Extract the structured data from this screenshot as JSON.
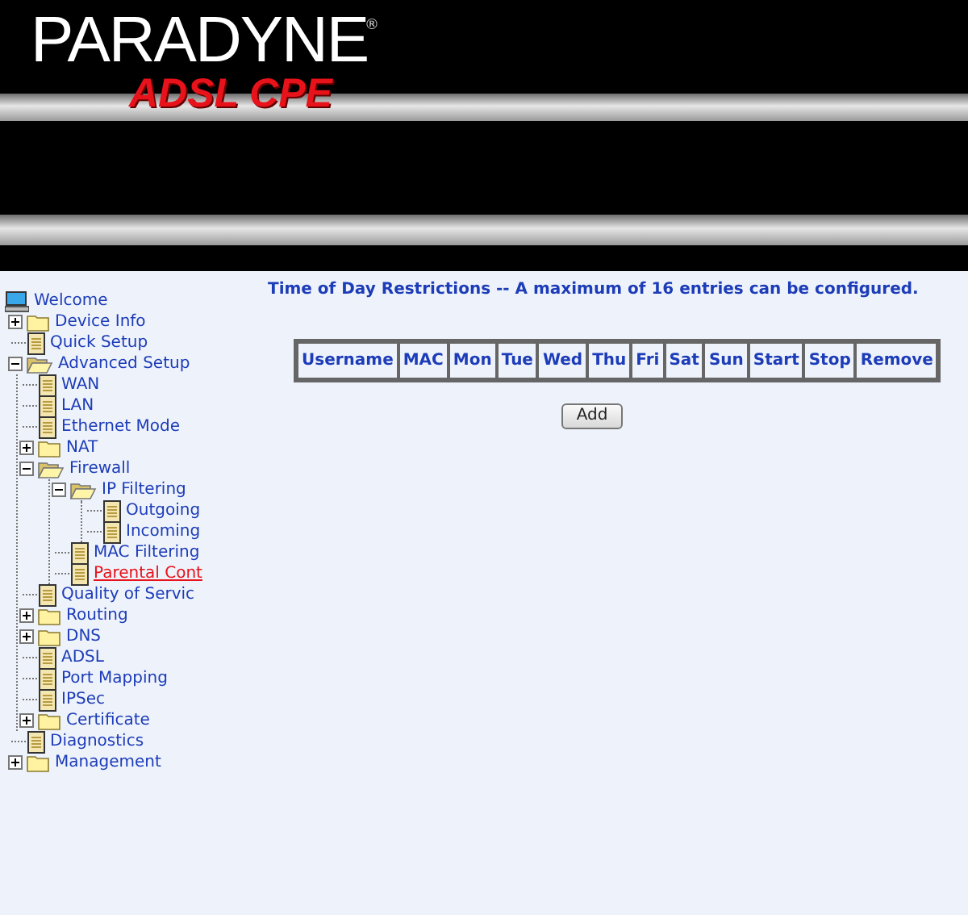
{
  "header": {
    "brand": "PARADYNE",
    "registered": "®",
    "product": "ADSL CPE"
  },
  "sidebar": {
    "tree": [
      {
        "label": "Welcome",
        "kind": "computer",
        "selected": false
      },
      {
        "label": "Device Info",
        "kind": "folder",
        "expanded": false,
        "selected": false
      },
      {
        "label": "Quick Setup",
        "kind": "page",
        "selected": false
      },
      {
        "label": "Advanced Setup",
        "kind": "folder",
        "expanded": true,
        "selected": false,
        "children": [
          {
            "label": "WAN",
            "kind": "page",
            "selected": false
          },
          {
            "label": "LAN",
            "kind": "page",
            "selected": false
          },
          {
            "label": "Ethernet Mode",
            "kind": "page",
            "selected": false
          },
          {
            "label": "NAT",
            "kind": "folder",
            "expanded": false,
            "selected": false
          },
          {
            "label": "Firewall",
            "kind": "folder",
            "expanded": true,
            "selected": false,
            "children": [
              {
                "label": "IP Filtering",
                "kind": "folder",
                "expanded": true,
                "selected": false,
                "children": [
                  {
                    "label": "Outgoing",
                    "kind": "page",
                    "selected": false
                  },
                  {
                    "label": "Incoming",
                    "kind": "page",
                    "selected": false
                  }
                ]
              },
              {
                "label": "MAC Filtering",
                "kind": "page",
                "selected": false
              },
              {
                "label": "Parental Cont",
                "kind": "page",
                "selected": true
              }
            ]
          },
          {
            "label": "Quality of Servic",
            "kind": "page",
            "selected": false
          },
          {
            "label": "Routing",
            "kind": "folder",
            "expanded": false,
            "selected": false
          },
          {
            "label": "DNS",
            "kind": "folder",
            "expanded": false,
            "selected": false
          },
          {
            "label": "ADSL",
            "kind": "page",
            "selected": false
          },
          {
            "label": "Port Mapping",
            "kind": "page",
            "selected": false
          },
          {
            "label": "IPSec",
            "kind": "page",
            "selected": false
          },
          {
            "label": "Certificate",
            "kind": "folder",
            "expanded": false,
            "selected": false
          }
        ]
      },
      {
        "label": "Diagnostics",
        "kind": "page",
        "selected": false
      },
      {
        "label": "Management",
        "kind": "folder",
        "expanded": false,
        "selected": false
      }
    ]
  },
  "content": {
    "title": "Time of Day Restrictions -- A maximum of 16 entries can be configured.",
    "table": {
      "columns": [
        "Username",
        "MAC",
        "Mon",
        "Tue",
        "Wed",
        "Thu",
        "Fri",
        "Sat",
        "Sun",
        "Start",
        "Stop",
        "Remove"
      ]
    },
    "buttons": [
      "Add"
    ]
  }
}
